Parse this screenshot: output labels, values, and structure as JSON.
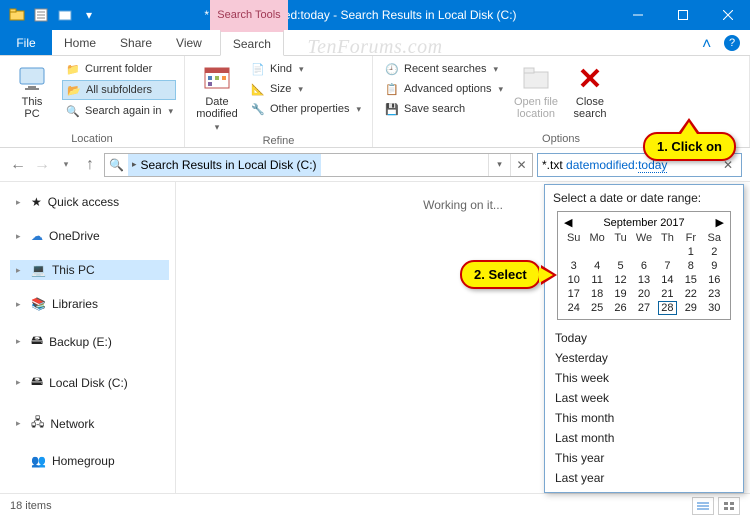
{
  "window": {
    "title": "*.txt datemodified:today - Search Results in Local Disk (C:)"
  },
  "tabs": {
    "file": "File",
    "home": "Home",
    "share": "Share",
    "view": "View",
    "search_context": "Search Tools",
    "search": "Search"
  },
  "ribbon": {
    "location": {
      "this_pc": "This\nPC",
      "current_folder": "Current folder",
      "all_subfolders": "All subfolders",
      "search_again_in": "Search again in",
      "label": "Location"
    },
    "refine": {
      "date_modified": "Date\nmodified",
      "kind": "Kind",
      "size": "Size",
      "other_properties": "Other properties",
      "label": "Refine"
    },
    "options": {
      "recent_searches": "Recent searches",
      "advanced_options": "Advanced options",
      "save_search": "Save search",
      "open_file_location": "Open file\nlocation",
      "close_search": "Close\nsearch",
      "label": "Options"
    }
  },
  "address": {
    "crumb": "Search Results in Local Disk (C:)"
  },
  "search": {
    "prefix": "*.txt ",
    "keyword": "datemodified:",
    "value": "today"
  },
  "sidebar": {
    "quick_access": "Quick access",
    "onedrive": "OneDrive",
    "this_pc": "This PC",
    "libraries": "Libraries",
    "backup": "Backup (E:)",
    "local_disk": "Local Disk (C:)",
    "network": "Network",
    "homegroup": "Homegroup"
  },
  "content": {
    "working": "Working on it..."
  },
  "status": {
    "items": "18 items"
  },
  "flyout": {
    "title": "Select a date or date range:",
    "month": "September 2017",
    "weekdays": [
      "Su",
      "Mo",
      "Tu",
      "We",
      "Th",
      "Fr",
      "Sa"
    ],
    "weeks": [
      [
        "",
        "",
        "",
        "",
        "",
        "1",
        "2"
      ],
      [
        "3",
        "4",
        "5",
        "6",
        "7",
        "8",
        "9"
      ],
      [
        "10",
        "11",
        "12",
        "13",
        "14",
        "15",
        "16"
      ],
      [
        "17",
        "18",
        "19",
        "20",
        "21",
        "22",
        "23"
      ],
      [
        "24",
        "25",
        "26",
        "27",
        "28",
        "29",
        "30"
      ]
    ],
    "today_cell": "28",
    "ranges": [
      "Today",
      "Yesterday",
      "This week",
      "Last week",
      "This month",
      "Last month",
      "This year",
      "Last year"
    ]
  },
  "callouts": {
    "c1": "1. Click on",
    "c2": "2. Select"
  },
  "watermark": "TenForums.com"
}
